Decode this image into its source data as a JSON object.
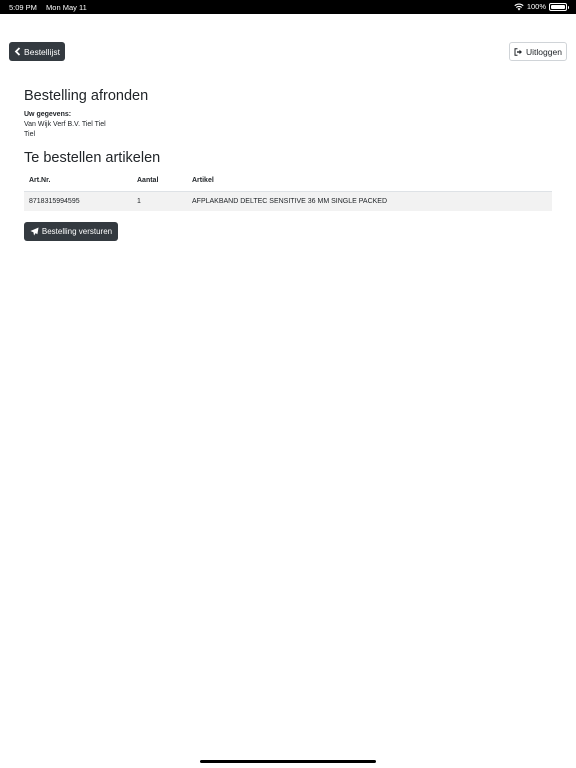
{
  "status_bar": {
    "time": "5:09 PM",
    "date": "Mon May 11",
    "battery": "100%",
    "icons": [
      "wifi-icon",
      "battery-icon"
    ]
  },
  "header": {
    "back_button": {
      "label": "Bestellijst",
      "icon": "chevron-left-icon"
    },
    "logout_button": {
      "label": "Uitloggen",
      "icon": "sign-out-icon"
    }
  },
  "page": {
    "title": "Bestelling afronden",
    "details_label": "Uw gegevens:",
    "details_line1": "Van Wijk Verf B.V. Tiel Tiel",
    "details_line2": "Tiel",
    "section_title": "Te bestellen artikelen"
  },
  "table": {
    "headers": [
      "Art.Nr.",
      "Aantal",
      "Artikel"
    ],
    "rows": [
      [
        "8718315994595",
        "1",
        "AFPLAKBAND DELTEC SENSITIVE 36 MM SINGLE PACKED"
      ]
    ]
  },
  "send_button": {
    "label": "Bestelling versturen",
    "icon": "paper-plane-icon"
  },
  "colors": {
    "dark_button": "#343a40",
    "row_stripe": "#f2f2f2",
    "text": "#212529"
  }
}
